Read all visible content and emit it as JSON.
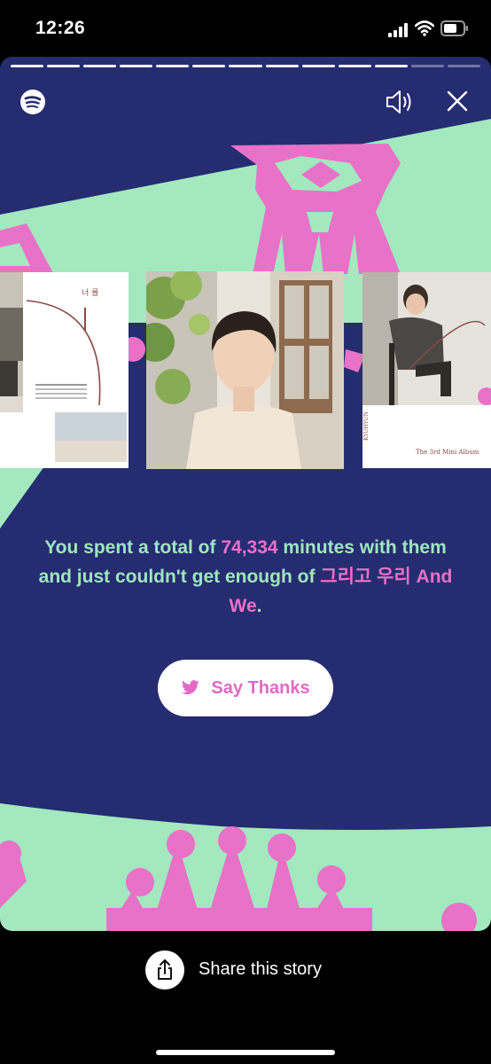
{
  "status_bar": {
    "time": "12:26"
  },
  "story": {
    "progress_total": 13,
    "progress_done": 11,
    "message": {
      "part1": "You spent a total of ",
      "minutes": "74,334",
      "part2": " minutes with them and just couldn't get enough of ",
      "song": "그리고 우리 And We",
      "part3": "."
    },
    "say_thanks_label": "Say Thanks",
    "covers": {
      "left": {
        "title_text": "너 를"
      },
      "right": {
        "caption": "The 3rd Mini Album",
        "artist": "KYUHYUN"
      }
    },
    "colors": {
      "background": "#262c70",
      "mint": "#a3e8bf",
      "pink": "#e872c8",
      "message": "#9fe6bf"
    }
  },
  "share": {
    "label": "Share this story"
  },
  "icons": [
    "spotify-logo-icon",
    "volume-icon",
    "close-icon",
    "twitter-icon",
    "share-icon",
    "signal-icon",
    "wifi-icon",
    "battery-icon"
  ]
}
